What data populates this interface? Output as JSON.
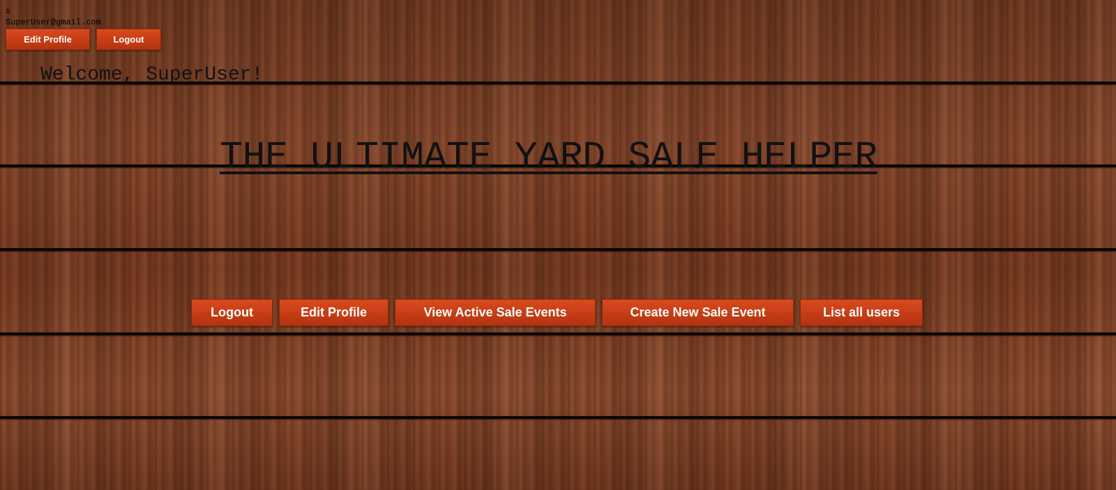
{
  "user": {
    "name_initial": "s",
    "email": "SuperUser@gmail.com"
  },
  "top_nav": {
    "edit_profile_label": "Edit Profile",
    "logout_label": "Logout"
  },
  "welcome_text": "Welcome, SuperUser!",
  "page_title": "THE ULTIMATE YARD SALE HELPER",
  "main_nav": {
    "logout_label": "Logout",
    "edit_profile_label": "Edit Profile",
    "view_active_label": "View Active Sale Events",
    "create_new_label": "Create New Sale Event",
    "list_users_label": "List all users"
  },
  "colors": {
    "button_bg": "#c53d15",
    "button_text": "#ffffff",
    "background_wood": "#7a3f24",
    "plank_line": "#0b0503"
  }
}
